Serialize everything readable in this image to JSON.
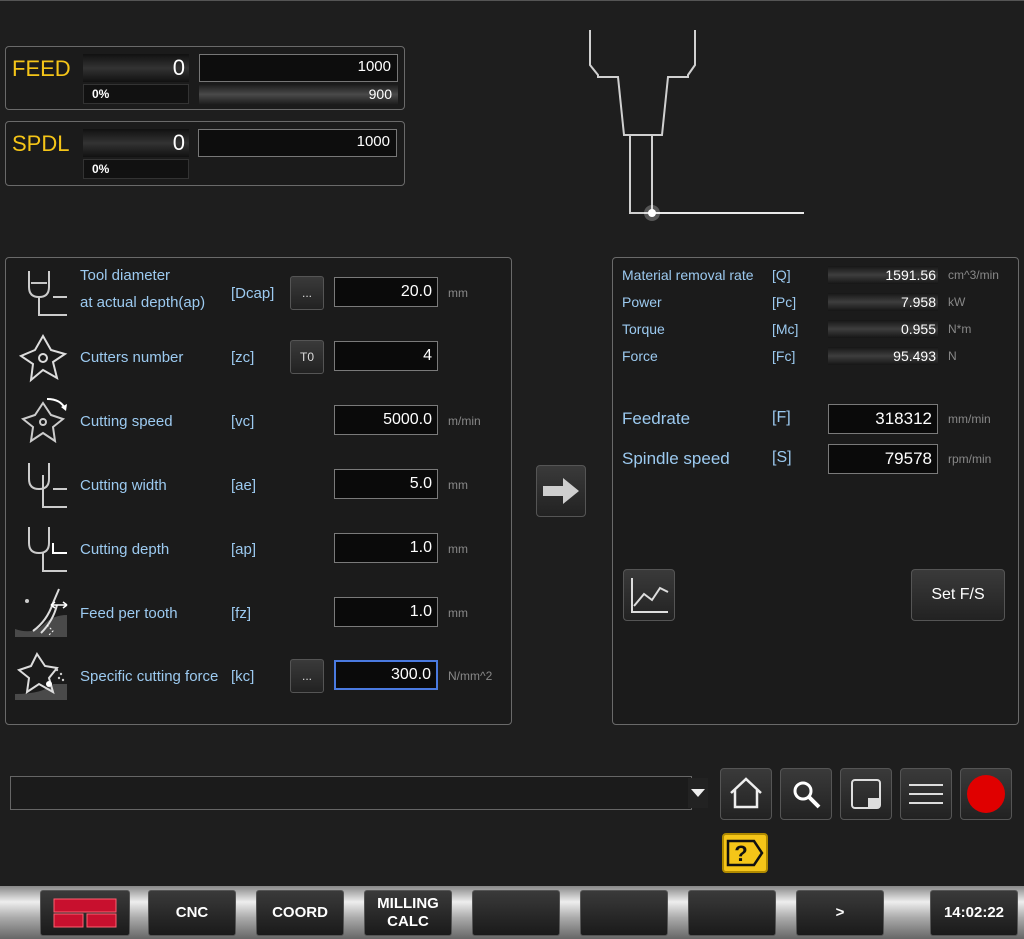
{
  "feed": {
    "label": "FEED",
    "value": "0",
    "percent": "0%",
    "max": "1000",
    "override": "900"
  },
  "spdl": {
    "label": "SPDL",
    "value": "0",
    "percent": "0%",
    "max": "1000"
  },
  "params": [
    {
      "label_line1": "Tool diameter",
      "label_line2": "at actual depth(ap)",
      "symbol": "[Dcap]",
      "button": "...",
      "value": "20.0",
      "unit": "mm"
    },
    {
      "label": "Cutters number",
      "symbol": "[zc]",
      "button": "T0",
      "value": "4",
      "unit": ""
    },
    {
      "label": "Cutting speed",
      "symbol": "[vc]",
      "value": "5000.0",
      "unit": "m/min"
    },
    {
      "label": "Cutting width",
      "symbol": "[ae]",
      "value": "5.0",
      "unit": "mm"
    },
    {
      "label": "Cutting depth",
      "symbol": "[ap]",
      "value": "1.0",
      "unit": "mm"
    },
    {
      "label": "Feed per tooth",
      "symbol": "[fz]",
      "value": "1.0",
      "unit": "mm"
    },
    {
      "label": "Specific cutting force",
      "symbol": "[kc]",
      "button": "...",
      "value": "300.0",
      "unit": "N/mm^2"
    }
  ],
  "results": [
    {
      "label": "Material removal rate",
      "symbol": "[Q]",
      "value": "1591.56",
      "unit": "cm^3/min"
    },
    {
      "label": "Power",
      "symbol": "[Pc]",
      "value": "7.958",
      "unit": "kW"
    },
    {
      "label": "Torque",
      "symbol": "[Mc]",
      "value": "0.955",
      "unit": "N*m"
    },
    {
      "label": "Force",
      "symbol": "[Fc]",
      "value": "95.493",
      "unit": "N"
    }
  ],
  "outputs": [
    {
      "label": "Feedrate",
      "symbol": "[F]",
      "value": "318312",
      "unit": "mm/min"
    },
    {
      "label": "Spindle speed",
      "symbol": "[S]",
      "value": "79578",
      "unit": "rpm/min"
    }
  ],
  "set_fs": "Set F/S",
  "command_input": "",
  "softkeys": {
    "cnc": "CNC",
    "coord": "COORD",
    "milling_line1": "MILLING",
    "milling_line2": "CALC",
    "next": ">"
  },
  "time": "14:02:22",
  "colors": {
    "accent_yellow": "#f5c518",
    "label_blue": "#9ccaf0",
    "alarm_red": "#e00000"
  }
}
